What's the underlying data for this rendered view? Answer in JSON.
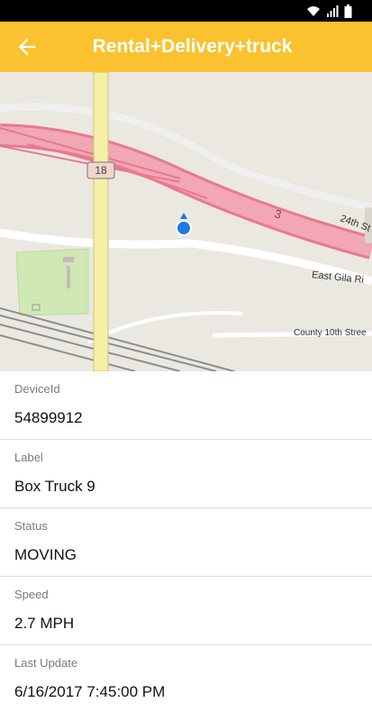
{
  "status_bar": {
    "icons": [
      "wifi-icon",
      "signal-icon",
      "battery-icon"
    ]
  },
  "app_bar": {
    "title": "Rental+Delivery+truck",
    "back_icon": "arrow-left-icon",
    "color": "#f9c22e"
  },
  "map": {
    "highway_shield": "18",
    "route_number": "3",
    "street_labels": [
      "24th St",
      "East Gila Ri",
      "County 10th Stree"
    ]
  },
  "details": [
    {
      "label": "DeviceId",
      "value": "54899912"
    },
    {
      "label": "Label",
      "value": "Box Truck 9"
    },
    {
      "label": "Status",
      "value": "MOVING"
    },
    {
      "label": "Speed",
      "value": "2.7 MPH"
    },
    {
      "label": "Last Update",
      "value": "6/16/2017 7:45:00 PM"
    }
  ]
}
